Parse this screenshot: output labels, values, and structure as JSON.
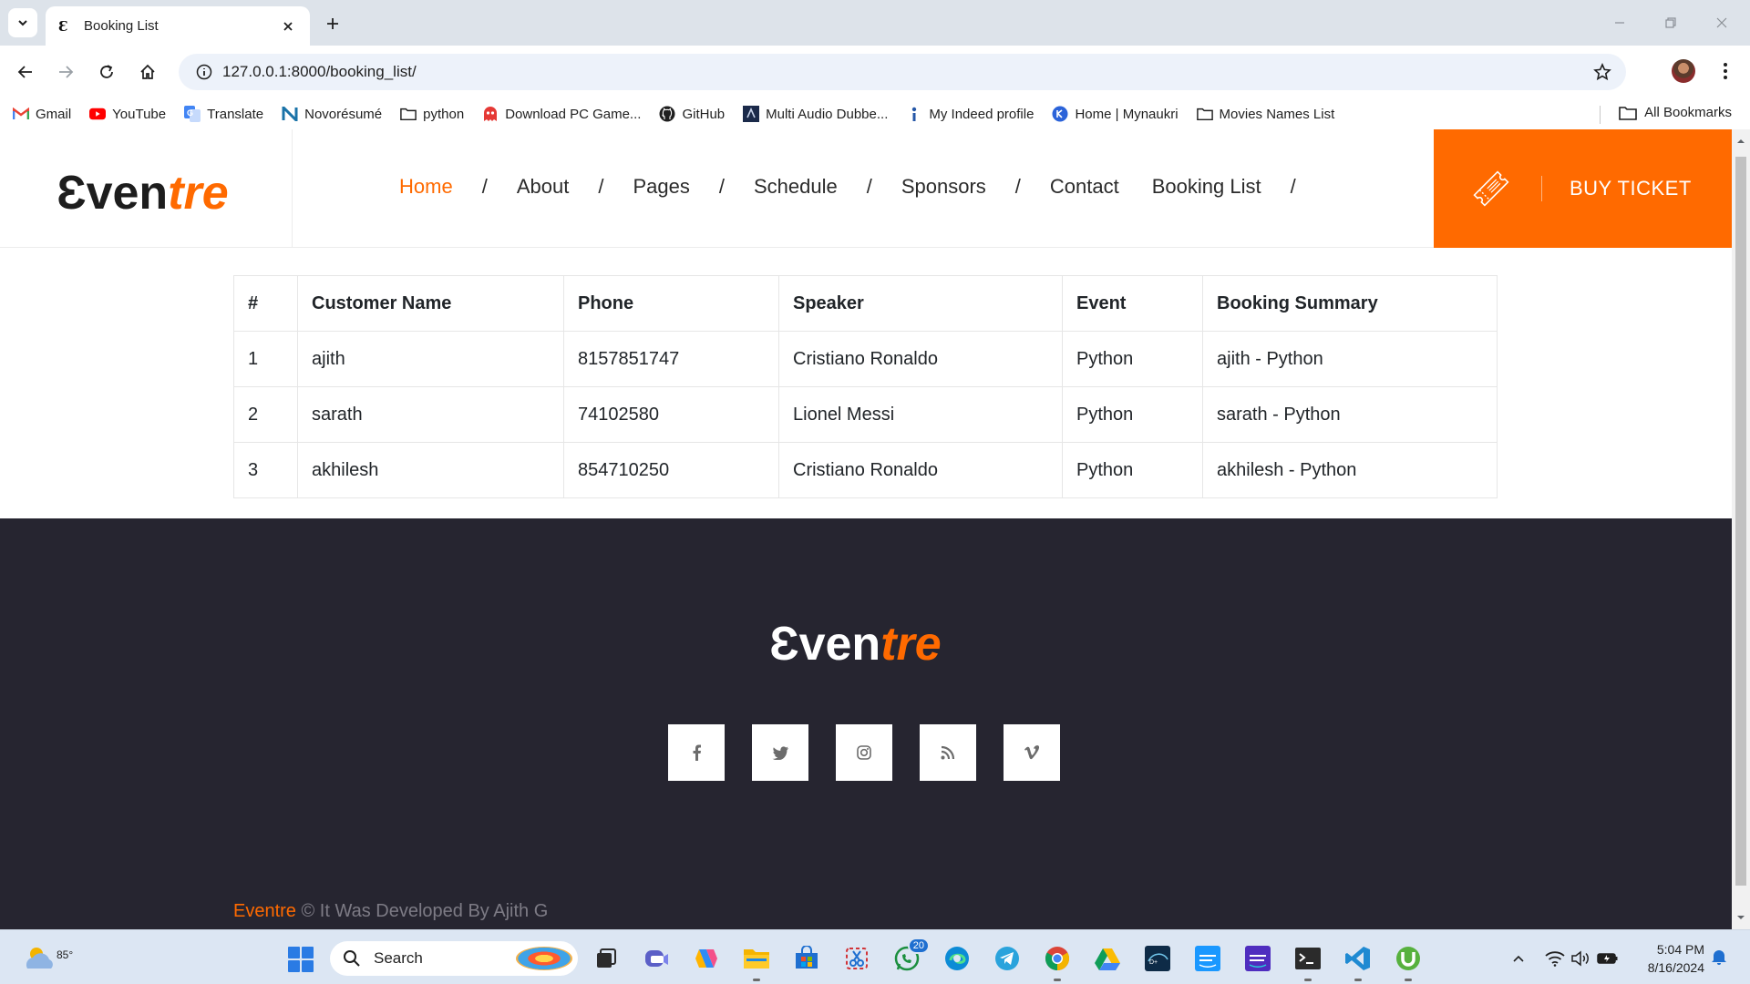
{
  "browser": {
    "tab_title": "Booking List",
    "tab_favicon": "Ɛ",
    "url": "127.0.0.1:8000/booking_list/",
    "bookmarks": [
      {
        "label": "Gmail",
        "icon": "gmail-icon"
      },
      {
        "label": "YouTube",
        "icon": "youtube-icon"
      },
      {
        "label": "Translate",
        "icon": "translate-icon"
      },
      {
        "label": "Novorésumé",
        "icon": "novoresume-icon"
      },
      {
        "label": "python",
        "icon": "folder-icon"
      },
      {
        "label": "Download PC Game...",
        "icon": "ghost-icon"
      },
      {
        "label": "GitHub",
        "icon": "github-icon"
      },
      {
        "label": "Multi Audio Dubbe...",
        "icon": "movie-icon"
      },
      {
        "label": "My Indeed profile",
        "icon": "indeed-icon"
      },
      {
        "label": "Home | Mynaukri",
        "icon": "naukri-icon"
      },
      {
        "label": "Movies Names List",
        "icon": "folder-icon"
      }
    ],
    "all_bookmarks": "All Bookmarks"
  },
  "site": {
    "logo_part1": "Ɛven",
    "logo_part2": "tre",
    "nav": [
      "Home",
      "About",
      "Pages",
      "Schedule",
      "Sponsors",
      "Contact",
      "Booking List"
    ],
    "nav_separator": "/",
    "buy_ticket": "BUY TICKET",
    "accent_color": "#ff6a00",
    "footer_bg": "#262530"
  },
  "table": {
    "headers": [
      "#",
      "Customer Name",
      "Phone",
      "Speaker",
      "Event",
      "Booking Summary"
    ],
    "rows": [
      [
        "1",
        "ajith",
        "8157851747",
        "Cristiano Ronaldo",
        "Python",
        "ajith - Python"
      ],
      [
        "2",
        "sarath",
        "74102580",
        "Lionel Messi",
        "Python",
        "sarath - Python"
      ],
      [
        "3",
        "akhilesh",
        "854710250",
        "Cristiano Ronaldo",
        "Python",
        "akhilesh - Python"
      ]
    ]
  },
  "footer": {
    "logo_part1": "Ɛven",
    "logo_part2": "tre",
    "socials": [
      "facebook-icon",
      "twitter-icon",
      "instagram-icon",
      "rss-icon",
      "vimeo-icon"
    ],
    "copyright_brand": "Eventre",
    "copyright_text": " © It Was Developed By Ajith G"
  },
  "taskbar": {
    "weather_temp": "85°",
    "search_label": "Search",
    "whatsapp_badge": "20",
    "time": "5:04 PM",
    "date": "8/16/2024"
  }
}
